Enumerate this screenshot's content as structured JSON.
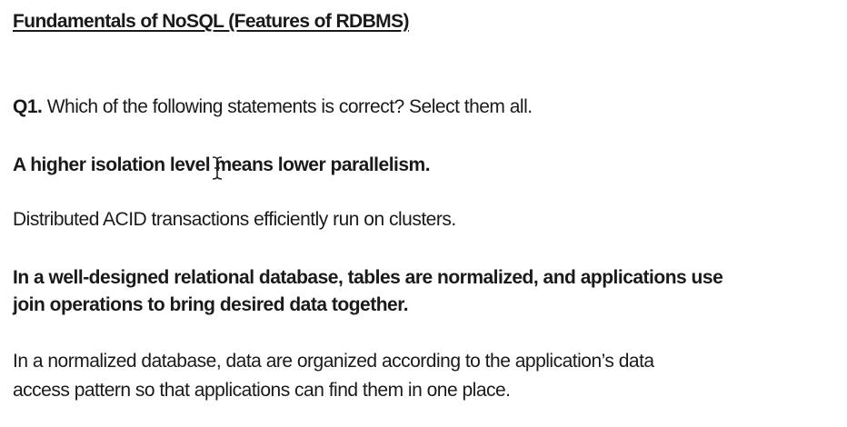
{
  "document": {
    "title": "Fundamentals of NoSQL  (Features of RDBMS)",
    "question": {
      "number": "Q1.",
      "text": " Which of the following statements is correct? Select them all."
    },
    "options": [
      {
        "text": "A higher isolation level means lower parallelism.",
        "emphasis": "bold"
      },
      {
        "text": "Distributed ACID transactions efficiently run on clusters.",
        "emphasis": "normal"
      },
      {
        "lines": [
          "In a well-designed relational database, tables are normalized, and applications use",
          "join operations to bring desired data together."
        ],
        "emphasis": "bold"
      },
      {
        "lines": [
          "In a normalized database, data are organized according to the application’s data",
          "access pattern so that applications can find them in one place."
        ],
        "emphasis": "normal"
      }
    ]
  },
  "cursor": {
    "icon": "text-cursor-icon"
  }
}
